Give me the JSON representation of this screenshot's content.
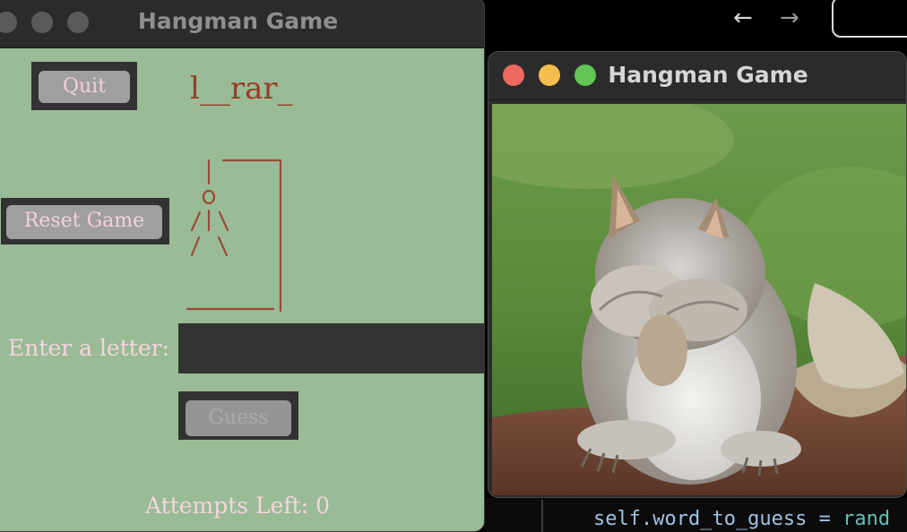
{
  "background": {
    "nav": {
      "back_icon": "left-arrow-icon",
      "forward_icon": "right-arrow-icon",
      "back_glyph": "←",
      "forward_glyph": "→"
    },
    "editor": {
      "code_prefix": "self.word_to_guess = ",
      "code_suffix": "rand"
    }
  },
  "main_window": {
    "title": "Hangman Game",
    "quit_label": "Quit",
    "reset_label": "Reset Game",
    "word_display": "l__rar_",
    "hangman_art": [
      " |",
      " O",
      "/|\\",
      "/ \\"
    ],
    "input_label": "Enter a letter:",
    "input_value": "",
    "guess_label": "Guess",
    "attempts_text": "Attempts Left: 0"
  },
  "image_window": {
    "title": "Hangman Game",
    "image_description_icon": "squirrel-facepalm-image"
  },
  "colors": {
    "window_bg": "#99bb95",
    "text_pink": "#f6d5df",
    "word_red": "#9a3a28",
    "button_gray": "#9f9f9f",
    "close": "#ed6a5e",
    "minimize": "#f5bf4f",
    "maximize": "#61c554"
  }
}
